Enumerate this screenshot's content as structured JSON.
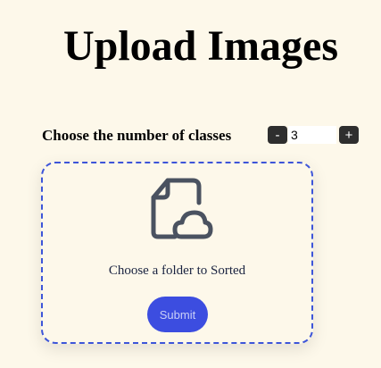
{
  "page": {
    "title": "Upload Images"
  },
  "classes": {
    "label": "Choose the number of classes",
    "decrement_label": "-",
    "increment_label": "+",
    "value": "3"
  },
  "dropzone": {
    "icon": "file-cloud-upload-icon",
    "text": "Choose a folder to Sorted",
    "submit_label": "Submit"
  },
  "colors": {
    "background": "#fdf8ea",
    "accent": "#3c4de0",
    "dashed_border": "#3d55d9",
    "icon": "#4a5260"
  }
}
